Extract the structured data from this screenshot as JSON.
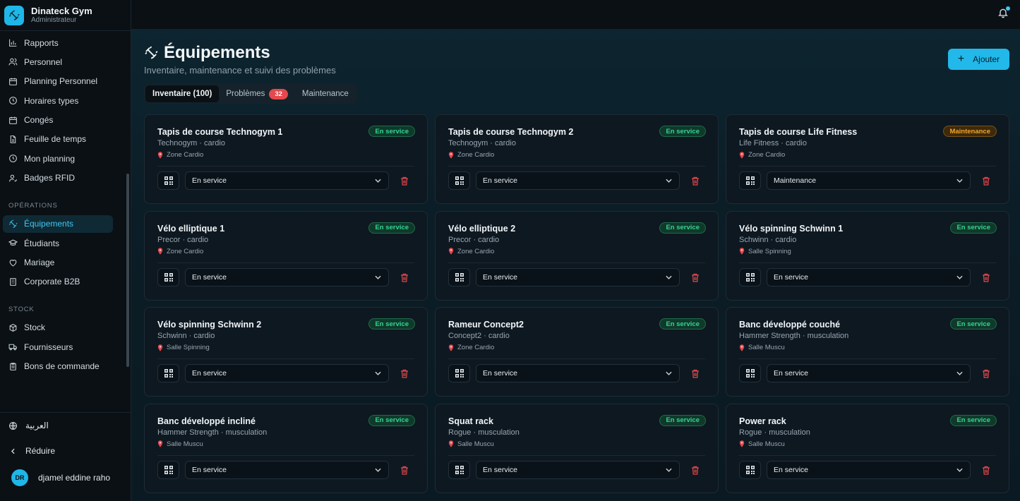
{
  "brand": {
    "title": "Dinateck Gym",
    "subtitle": "Administrateur"
  },
  "sidebar": {
    "items_top": [
      {
        "label": "Rapports",
        "icon": "bar-chart-icon"
      },
      {
        "label": "Personnel",
        "icon": "users-icon"
      },
      {
        "label": "Planning Personnel",
        "icon": "calendar-icon"
      },
      {
        "label": "Horaires types",
        "icon": "clock-icon"
      },
      {
        "label": "Congés",
        "icon": "calendar-off-icon"
      },
      {
        "label": "Feuille de temps",
        "icon": "file-icon"
      },
      {
        "label": "Mon planning",
        "icon": "clock-icon"
      },
      {
        "label": "Badges RFID",
        "icon": "user-badge-icon"
      }
    ],
    "section_operations": "OPÉRATIONS",
    "items_operations": [
      {
        "label": "Équipements",
        "icon": "dumbbell-icon",
        "active": true
      },
      {
        "label": "Étudiants",
        "icon": "graduation-cap-icon"
      },
      {
        "label": "Mariage",
        "icon": "heart-icon"
      },
      {
        "label": "Corporate B2B",
        "icon": "building-icon"
      }
    ],
    "section_stock": "STOCK",
    "items_stock": [
      {
        "label": "Stock",
        "icon": "package-icon"
      },
      {
        "label": "Fournisseurs",
        "icon": "truck-icon"
      },
      {
        "label": "Bons de commande",
        "icon": "clipboard-icon"
      }
    ],
    "language": "العربية",
    "collapse": "Réduire",
    "user": {
      "initials": "DR",
      "name": "djamel eddine raho"
    }
  },
  "header": {
    "title": "Équipements",
    "subtitle": "Inventaire, maintenance et suivi des problèmes",
    "add_label": "Ajouter"
  },
  "tabs": [
    {
      "label": "Inventaire (100)",
      "active": true
    },
    {
      "label": "Problèmes",
      "count": "32"
    },
    {
      "label": "Maintenance"
    }
  ],
  "colors": {
    "accent": "#22b8ea",
    "ok": "#34d399",
    "maintenance": "#f5a524",
    "danger": "#e5484d"
  },
  "equipment": [
    {
      "name": "Tapis de course Technogym 1",
      "meta": "Technogym · cardio",
      "location": "Zone Cardio",
      "badge": "En service",
      "status": "ok",
      "select": "En service"
    },
    {
      "name": "Tapis de course Technogym 2",
      "meta": "Technogym · cardio",
      "location": "Zone Cardio",
      "badge": "En service",
      "status": "ok",
      "select": "En service"
    },
    {
      "name": "Tapis de course Life Fitness",
      "meta": "Life Fitness · cardio",
      "location": "Zone Cardio",
      "badge": "Maintenance",
      "status": "maint",
      "select": "Maintenance"
    },
    {
      "name": "Vélo elliptique 1",
      "meta": "Precor · cardio",
      "location": "Zone Cardio",
      "badge": "En service",
      "status": "ok",
      "select": "En service"
    },
    {
      "name": "Vélo elliptique 2",
      "meta": "Precor · cardio",
      "location": "Zone Cardio",
      "badge": "En service",
      "status": "ok",
      "select": "En service"
    },
    {
      "name": "Vélo spinning Schwinn 1",
      "meta": "Schwinn · cardio",
      "location": "Salle Spinning",
      "badge": "En service",
      "status": "ok",
      "select": "En service"
    },
    {
      "name": "Vélo spinning Schwinn 2",
      "meta": "Schwinn · cardio",
      "location": "Salle Spinning",
      "badge": "En service",
      "status": "ok",
      "select": "En service"
    },
    {
      "name": "Rameur Concept2",
      "meta": "Concept2 · cardio",
      "location": "Zone Cardio",
      "badge": "En service",
      "status": "ok",
      "select": "En service"
    },
    {
      "name": "Banc développé couché",
      "meta": "Hammer Strength · musculation",
      "location": "Salle Muscu",
      "badge": "En service",
      "status": "ok",
      "select": "En service"
    },
    {
      "name": "Banc développé incliné",
      "meta": "Hammer Strength · musculation",
      "location": "Salle Muscu",
      "badge": "En service",
      "status": "ok",
      "select": "En service"
    },
    {
      "name": "Squat rack",
      "meta": "Rogue · musculation",
      "location": "Salle Muscu",
      "badge": "En service",
      "status": "ok",
      "select": "En service"
    },
    {
      "name": "Power rack",
      "meta": "Rogue · musculation",
      "location": "Salle Muscu",
      "badge": "En service",
      "status": "ok",
      "select": "En service"
    }
  ]
}
